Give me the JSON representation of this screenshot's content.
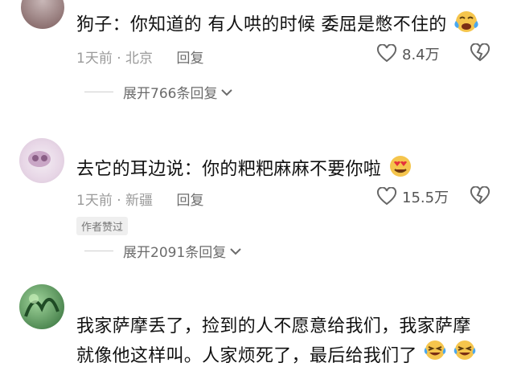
{
  "comments": [
    {
      "text": "狗子：你知道的 有人哄的时候 委屈是憋不住的",
      "time": "1天前",
      "location": "北京",
      "reply": "回复",
      "likes": "8.4万",
      "expand": "展开766条回复",
      "emoji": "crying-face"
    },
    {
      "text": "去它的耳边说：你的粑粑麻麻不要你啦",
      "time": "1天前",
      "location": "新疆",
      "reply": "回复",
      "likes": "15.5万",
      "badge": "作者赞过",
      "expand": "展开2091条回复",
      "emoji": "heart-eyes-face"
    },
    {
      "text_line1": "我家萨摩丢了，捡到的人不愿意给我们，我家萨摩",
      "text_line2": "就像他这样叫。人家烦死了，最后给我们了",
      "emoji": "laughing-crying-face"
    }
  ]
}
